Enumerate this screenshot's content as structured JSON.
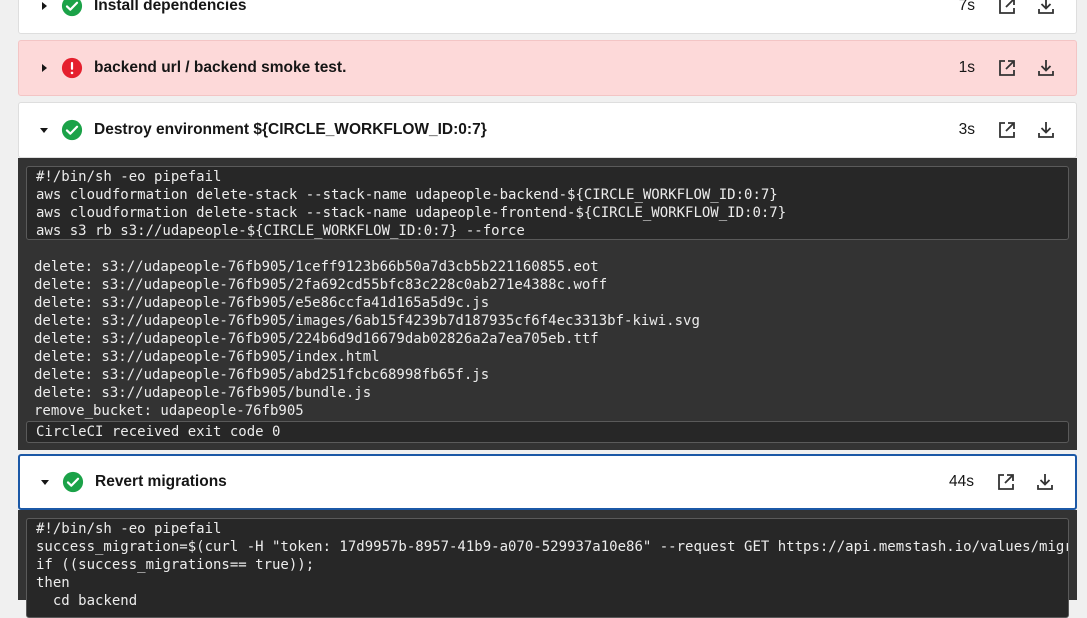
{
  "steps": [
    {
      "title": "Install dependencies",
      "duration": "7s",
      "status": "success",
      "expanded": false
    },
    {
      "title": "backend url / backend smoke test.",
      "duration": "1s",
      "status": "failed",
      "expanded": false
    },
    {
      "title": "Destroy environment ${CIRCLE_WORKFLOW_ID:0:7}",
      "duration": "3s",
      "status": "success",
      "expanded": true
    },
    {
      "title": "Revert migrations",
      "duration": "44s",
      "status": "success",
      "expanded": true
    }
  ],
  "destroy_console": {
    "command": "#!/bin/sh -eo pipefail\naws cloudformation delete-stack --stack-name udapeople-backend-${CIRCLE_WORKFLOW_ID:0:7}\naws cloudformation delete-stack --stack-name udapeople-frontend-${CIRCLE_WORKFLOW_ID:0:7}\naws s3 rb s3://udapeople-${CIRCLE_WORKFLOW_ID:0:7} --force",
    "output": "delete: s3://udapeople-76fb905/1ceff9123b66b50a7d3cb5b221160855.eot\ndelete: s3://udapeople-76fb905/2fa692cd55bfc83c228c0ab271e4388c.woff\ndelete: s3://udapeople-76fb905/e5e86ccfa41d165a5d9c.js\ndelete: s3://udapeople-76fb905/images/6ab15f4239b7d187935cf6f4ec3313bf-kiwi.svg\ndelete: s3://udapeople-76fb905/224b6d9d16679dab02826a2a7ea705eb.ttf\ndelete: s3://udapeople-76fb905/index.html\ndelete: s3://udapeople-76fb905/abd251fcbc68998fb65f.js\ndelete: s3://udapeople-76fb905/bundle.js\nremove_bucket: udapeople-76fb905",
    "exit": "CircleCI received exit code 0"
  },
  "revert_console": {
    "command": "#!/bin/sh -eo pipefail\nsuccess_migration=$(curl -H \"token: 17d9957b-8957-41b9-a070-529937a10e86\" --request GET https://api.memstash.io/values/migra\nif ((success_migrations== true));\nthen\n  cd backend"
  },
  "icons": {
    "expand": "caret-right-icon",
    "collapse": "caret-down-icon",
    "success": "check-circle-icon",
    "failed": "error-circle-icon",
    "open": "open-in-new-icon",
    "download": "download-icon"
  },
  "colors": {
    "success": "#1ba248",
    "failed": "#e5202e",
    "active_border": "#1b58a6",
    "failed_bg": "#fdd9d9",
    "console_bg": "#333333"
  }
}
